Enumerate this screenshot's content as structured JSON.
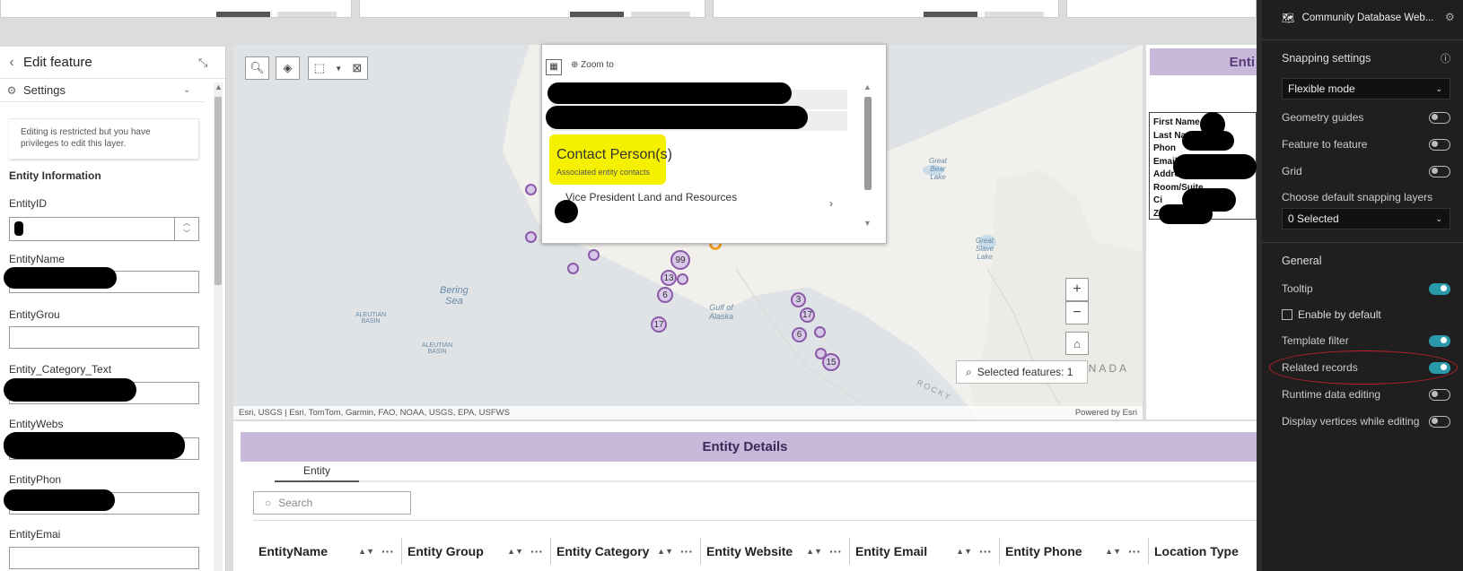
{
  "left_panel": {
    "title": "Edit feature",
    "settings_label": "Settings",
    "notice": "Editing is restricted but you have privileges to edit this layer.",
    "section_title": "Entity Information",
    "fields": [
      {
        "label": "EntityID"
      },
      {
        "label": "EntityName"
      },
      {
        "label": "EntityGrou"
      },
      {
        "label": "Entity_Category_Text"
      },
      {
        "label": "EntityWebs"
      },
      {
        "label": "EntityPhon"
      },
      {
        "label": "EntityEmai"
      }
    ]
  },
  "map": {
    "labels": {
      "bering": "Bering\nSea",
      "aleutian1": "ALEUTIAN\nBASIN",
      "aleutian2": "ALEUTIAN\nBASIN",
      "gulf": "Gulf of\nAlaska",
      "great_bear": "Great\nBear\nLake",
      "great_slave": "Great\nSlave\nLake",
      "canada": "CANADA",
      "rocky": "ROCKY"
    },
    "clusters": [
      "99",
      "13",
      "6",
      "17",
      "3",
      "17",
      "6",
      "15"
    ],
    "attribution": "Esri, USGS | Esri, TomTom, Garmin, FAO, NOAA, USGS, EPA, USFWS",
    "powered_by": "Powered by Esri",
    "selected_features": "Selected features: 1",
    "zoom_in": "+",
    "zoom_out": "−"
  },
  "popup": {
    "zoom_to": "Zoom to",
    "related_title": "Contact Person(s)",
    "related_subtitle": "Associated entity contacts",
    "record": "Vice President Land and Resources"
  },
  "entity_card": {
    "title": "Enti",
    "lines": [
      "First Name",
      "Last Name",
      "Phon",
      "Email:",
      "Addres",
      "Room/Suite",
      "Ci",
      "Zi"
    ]
  },
  "bottom": {
    "title": "Entity Details",
    "tab": "Entity",
    "search_placeholder": "Search",
    "columns": [
      "EntityName",
      "Entity Group",
      "Entity Category",
      "Entity Website",
      "Entity Email",
      "Entity Phone",
      "Location Type"
    ]
  },
  "right_panel": {
    "app_title": "Community Database Web...",
    "snapping_title": "Snapping settings",
    "mode": "Flexible mode",
    "geometry_guides": "Geometry guides",
    "feature_to_feature": "Feature to feature",
    "grid": "Grid",
    "default_layers_label": "Choose default snapping layers",
    "selected": "0 Selected",
    "general": "General",
    "tooltip": "Tooltip",
    "enable_default": "Enable by default",
    "template_filter": "Template filter",
    "related_records": "Related records",
    "runtime_editing": "Runtime data editing",
    "display_vertices": "Display vertices while editing"
  },
  "colors": {
    "accent": "#2a9aaa",
    "purple_header": "#c8b8da",
    "highlight": "#f5f000"
  }
}
